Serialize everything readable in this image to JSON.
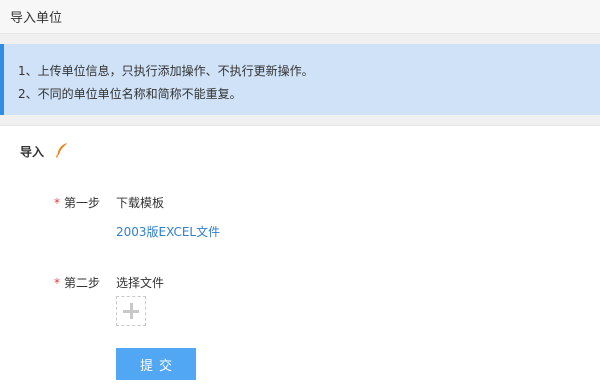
{
  "header": {
    "title": "导入单位"
  },
  "notice": {
    "line1": "1、上传单位信息，只执行添加操作、不执行更新操作。",
    "line2": "2、不同的单位单位名称和简称不能重复。"
  },
  "form": {
    "title": "导入",
    "step1": {
      "required_mark": "*",
      "label": "第一步",
      "value": "下载模板",
      "link": "2003版EXCEL文件"
    },
    "step2": {
      "required_mark": "*",
      "label": "第二步",
      "value": "选择文件"
    },
    "submit_label": "提交"
  },
  "colors": {
    "accent": "#2f8de4",
    "button": "#52a7f5",
    "required": "#e4393c",
    "feather": "#f07d14"
  },
  "icons": {
    "title_icon": "feather-icon",
    "upload_icon": "plus-icon"
  }
}
